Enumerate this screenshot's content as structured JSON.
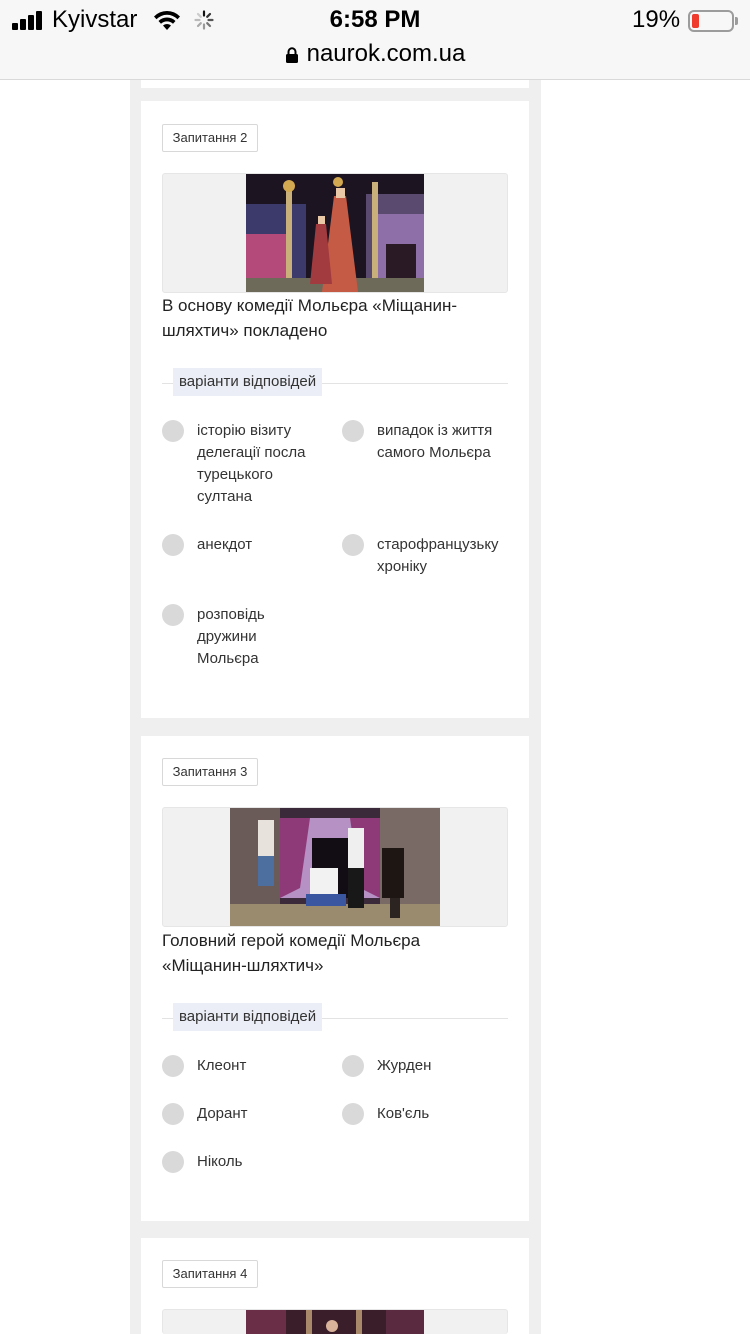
{
  "status_bar": {
    "carrier": "Kyivstar",
    "time": "6:58 PM",
    "battery_percent": "19%",
    "battery_level": 0.19,
    "battery_color": "#ef3b2d",
    "icons": [
      "signal-icon",
      "wifi-icon",
      "loading-spinner-icon",
      "battery-icon"
    ]
  },
  "browser": {
    "url": "naurok.com.ua",
    "lock_icon": "lock-icon"
  },
  "questions": [
    {
      "badge": "Запитання 2",
      "text": "В основу комедії Мольєра «Міщанин-шляхтич» покладено",
      "answers_label": "варіанти відповідей",
      "options": [
        "історію візиту делегації посла турецького султана",
        "випадок із життя самого Мольєра",
        "анекдот",
        "старофранцузьку хроніку",
        "розповідь дружини Мольєра"
      ]
    },
    {
      "badge": "Запитання 3",
      "text": "Головний герой комедії Мольєра «Міщанин-шляхтич»",
      "answers_label": "варіанти відповідей",
      "options": [
        "Клеонт",
        "Журден",
        "Дорант",
        "Ков'єль",
        "Ніколь"
      ]
    },
    {
      "badge": "Запитання 4"
    }
  ]
}
